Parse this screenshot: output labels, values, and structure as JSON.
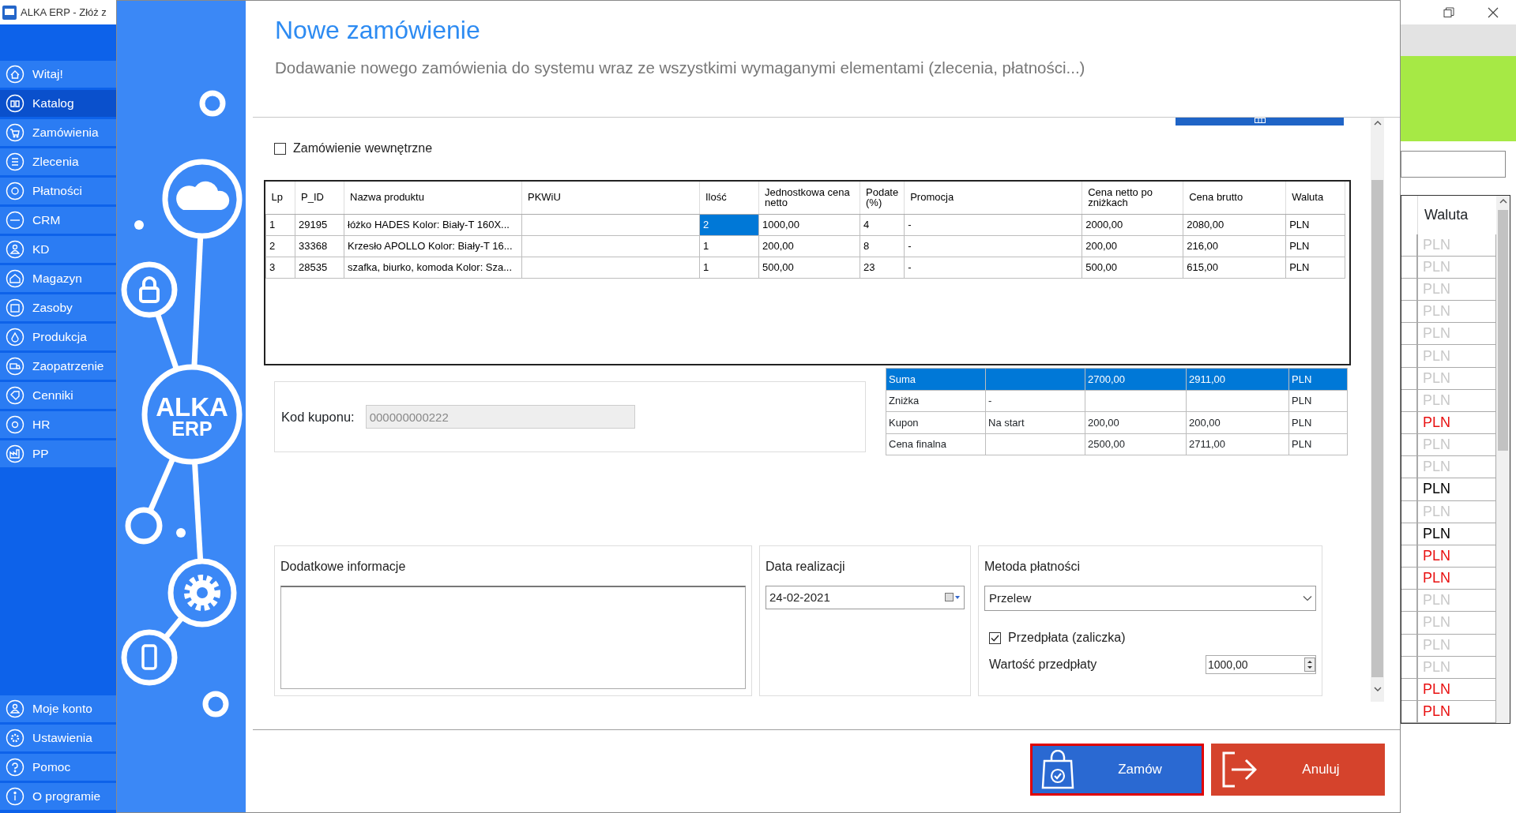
{
  "background_window": {
    "title": "ALKA ERP - Złóż z",
    "sidebar": {
      "items": [
        {
          "label": "Witaj!",
          "selected": false
        },
        {
          "label": "Katalog",
          "selected": true
        },
        {
          "label": "Zamówienia",
          "selected": false
        },
        {
          "label": "Zlecenia",
          "selected": false
        },
        {
          "label": "Płatności",
          "selected": false
        },
        {
          "label": "CRM",
          "selected": false
        },
        {
          "label": "KD",
          "selected": false
        },
        {
          "label": "Magazyn",
          "selected": false
        },
        {
          "label": "Zasoby",
          "selected": false
        },
        {
          "label": "Produkcja",
          "selected": false
        },
        {
          "label": "Zaopatrzenie",
          "selected": false
        },
        {
          "label": "Cenniki",
          "selected": false
        },
        {
          "label": "HR",
          "selected": false
        },
        {
          "label": "PP",
          "selected": false
        }
      ],
      "bottom_items": [
        {
          "label": "Moje konto",
          "selected": false
        },
        {
          "label": "Ustawienia",
          "selected": false
        },
        {
          "label": "Pomoc",
          "selected": false
        },
        {
          "label": "O programie",
          "selected": false
        }
      ]
    },
    "table": {
      "column": "Waluta",
      "cells": [
        {
          "text": "PLN",
          "color": "#c8c8c8"
        },
        {
          "text": "PLN",
          "color": "#c8c8c8"
        },
        {
          "text": "PLN",
          "color": "#c8c8c8"
        },
        {
          "text": "PLN",
          "color": "#c8c8c8"
        },
        {
          "text": "PLN",
          "color": "#c8c8c8"
        },
        {
          "text": "PLN",
          "color": "#c8c8c8"
        },
        {
          "text": "PLN",
          "color": "#c8c8c8"
        },
        {
          "text": "PLN",
          "color": "#c8c8c8"
        },
        {
          "text": "PLN",
          "color": "#e81010"
        },
        {
          "text": "PLN",
          "color": "#c8c8c8"
        },
        {
          "text": "PLN",
          "color": "#c8c8c8"
        },
        {
          "text": "PLN",
          "color": "#000000"
        },
        {
          "text": "PLN",
          "color": "#c8c8c8"
        },
        {
          "text": "PLN",
          "color": "#000000"
        },
        {
          "text": "PLN",
          "color": "#e81010"
        },
        {
          "text": "PLN",
          "color": "#e81010"
        },
        {
          "text": "PLN",
          "color": "#c8c8c8"
        },
        {
          "text": "PLN",
          "color": "#c8c8c8"
        },
        {
          "text": "PLN",
          "color": "#c8c8c8"
        },
        {
          "text": "PLN",
          "color": "#c8c8c8"
        },
        {
          "text": "PLN",
          "color": "#e81010"
        },
        {
          "text": "PLN",
          "color": "#e81010"
        }
      ]
    }
  },
  "logo": {
    "line_1": "ALKA",
    "line_2": "ERP"
  },
  "dialog": {
    "title": "Nowe zamówienie",
    "subtitle": "Dodawanie nowego zamówienia do systemu wraz ze wszystkimi wymaganymi elementami (zlecenia, płatności...)",
    "internal_order": {
      "label": "Zamówienie wewnętrzne",
      "checked": false
    },
    "products": {
      "columns": [
        "Lp",
        "P_ID",
        "Nazwa produktu",
        "PKWiU",
        "Ilość",
        "Jednostkowa cena netto",
        "Podate (%)",
        "Promocja",
        "Cena netto po zniżkach",
        "Cena brutto",
        "Waluta"
      ],
      "rows": [
        {
          "lp": "1",
          "p_id": "29195",
          "name": "łóżko HADES Kolor: Biały-T 160X...",
          "qty": "2",
          "qty_selected": true,
          "unit_net": "1000,00",
          "tax": "4",
          "promo": "-",
          "net_after": "2000,00",
          "gross": "2080,00",
          "currency": "PLN"
        },
        {
          "lp": "2",
          "p_id": "33368",
          "name": "Krzesło APOLLO Kolor: Biały-T 16...",
          "qty": "1",
          "qty_selected": false,
          "unit_net": "200,00",
          "tax": "8",
          "promo": "-",
          "net_after": "200,00",
          "gross": "216,00",
          "currency": "PLN"
        },
        {
          "lp": "3",
          "p_id": "28535",
          "name": "szafka, biurko, komoda Kolor: Sza...",
          "qty": "1",
          "qty_selected": false,
          "unit_net": "500,00",
          "tax": "23",
          "promo": "-",
          "net_after": "500,00",
          "gross": "615,00",
          "currency": "PLN"
        }
      ]
    },
    "coupon": {
      "label": "Kod kuponu:",
      "value": "000000000222"
    },
    "totals": {
      "rows": [
        {
          "label": "Suma",
          "net": "2700,00",
          "gross": "2911,00",
          "currency": "PLN",
          "selected": true
        },
        {
          "label": "Zniżka",
          "detail": "-",
          "currency": "PLN",
          "selected": false
        },
        {
          "label": "Kupon",
          "detail": "Na start",
          "net": "200,00",
          "gross": "200,00",
          "currency": "PLN",
          "selected": false
        },
        {
          "label": "Cena finalna",
          "net": "2500,00",
          "gross": "2711,00",
          "currency": "PLN",
          "selected": false
        }
      ]
    },
    "notes": {
      "label": "Dodatkowe informacje"
    },
    "date": {
      "label": "Data realizacji",
      "value": "24-02-2021"
    },
    "payment": {
      "label": "Metoda płatności",
      "method": "Przelew",
      "prepayment": {
        "label": "Przedpłata (zaliczka)",
        "checked": true
      },
      "amount_label": "Wartość przedpłaty",
      "amount": "1000,00"
    },
    "buttons": [
      {
        "label": "Zamów",
        "kind": "confirm",
        "focused": true
      },
      {
        "label": "Anuluj",
        "kind": "cancel",
        "focused": false
      }
    ]
  }
}
